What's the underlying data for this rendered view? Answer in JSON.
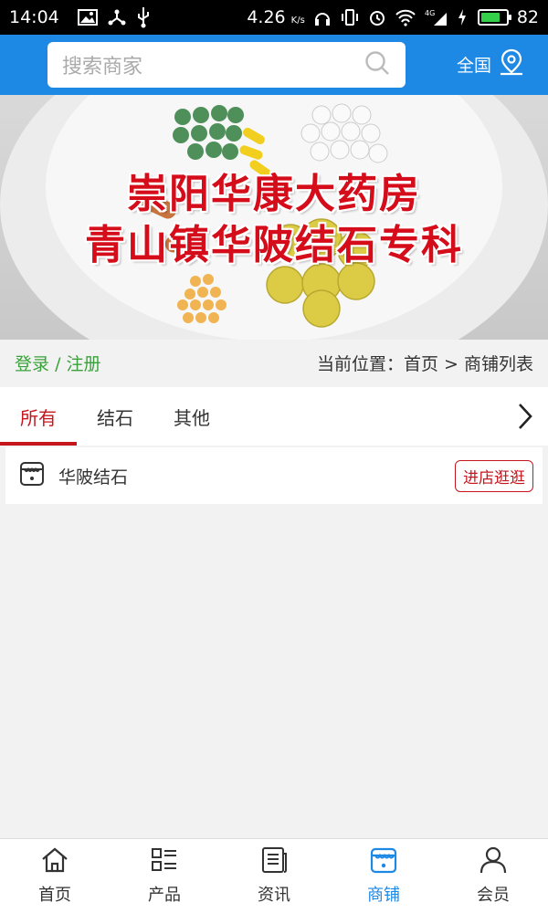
{
  "status_bar": {
    "time": "14:04",
    "network_speed": "4.26",
    "speed_unit": "K/s",
    "signal_label": "4G",
    "battery": "82",
    "battery_level": 0.82,
    "battery_color": "#35d04a"
  },
  "header": {
    "search_placeholder": "搜索商家",
    "region_label": "全国",
    "bg_color": "#1e88e5"
  },
  "banner": {
    "line1": "崇阳华康大药房",
    "line2": "青山镇华陂结石专科",
    "text_color": "#d50c1a"
  },
  "info_bar": {
    "login": "登录",
    "separator": "/",
    "register": "注册",
    "location_label": "当前位置：",
    "crumb_home": "首页",
    "crumb_sep": ">",
    "crumb_current": "商铺列表"
  },
  "tabs": {
    "items": [
      {
        "label": "所有",
        "active": true
      },
      {
        "label": "结石",
        "active": false
      },
      {
        "label": "其他",
        "active": false
      }
    ],
    "accent_color": "#c5161d"
  },
  "stores": [
    {
      "name": "华陂结石",
      "action": "进店逛逛"
    }
  ],
  "bottom_nav": {
    "items": [
      {
        "label": "首页",
        "icon": "home-icon",
        "active": false
      },
      {
        "label": "产品",
        "icon": "grid-list-icon",
        "active": false
      },
      {
        "label": "资讯",
        "icon": "news-icon",
        "active": false
      },
      {
        "label": "商铺",
        "icon": "store-icon",
        "active": true
      },
      {
        "label": "会员",
        "icon": "user-icon",
        "active": false
      }
    ],
    "active_color": "#1e88e5"
  }
}
